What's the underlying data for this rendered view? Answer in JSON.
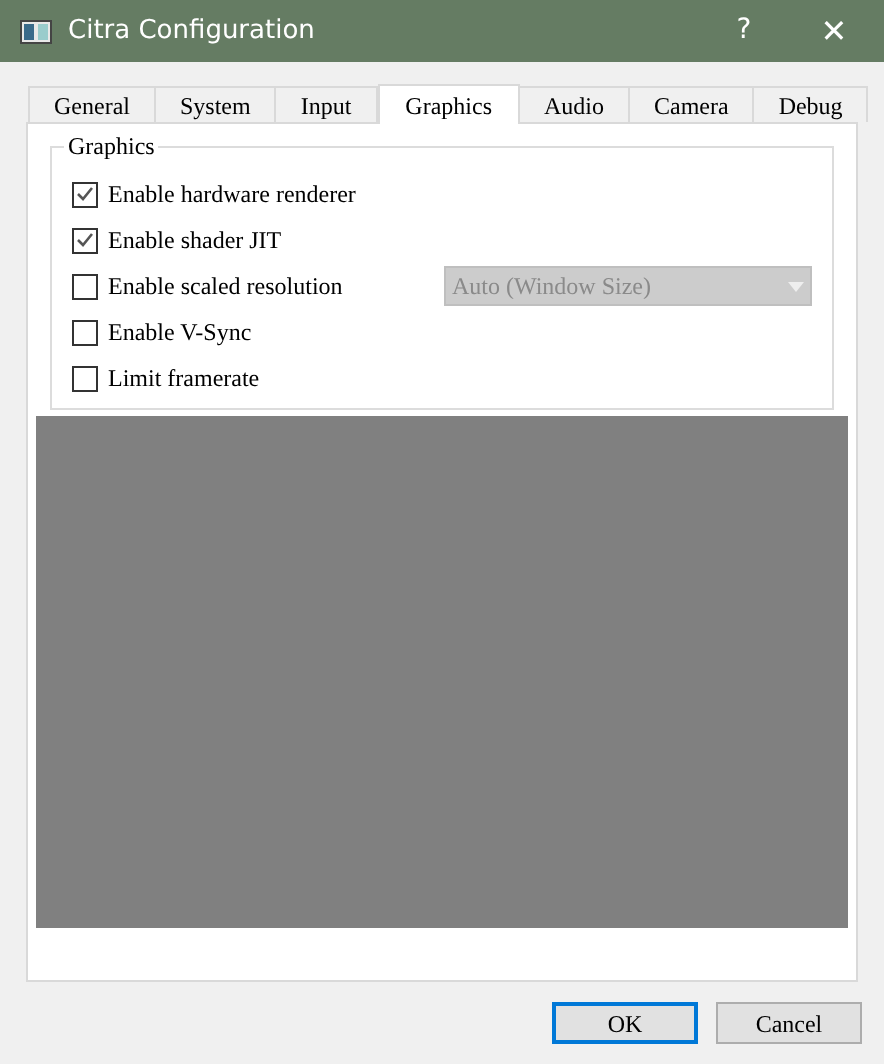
{
  "window": {
    "title": "Citra Configuration",
    "help": "?",
    "close": "✕"
  },
  "tabs": [
    {
      "label": "General",
      "selected": false
    },
    {
      "label": "System",
      "selected": false
    },
    {
      "label": "Input",
      "selected": false
    },
    {
      "label": "Graphics",
      "selected": true
    },
    {
      "label": "Audio",
      "selected": false
    },
    {
      "label": "Camera",
      "selected": false
    },
    {
      "label": "Debug",
      "selected": false
    }
  ],
  "group": {
    "title": "Graphics",
    "options": [
      {
        "label": "Enable hardware renderer",
        "checked": true
      },
      {
        "label": "Enable shader JIT",
        "checked": true
      },
      {
        "label": "Enable scaled resolution",
        "checked": false,
        "dropdown": {
          "value": "Auto (Window Size)",
          "disabled": true
        }
      },
      {
        "label": "Enable V-Sync",
        "checked": false
      },
      {
        "label": "Limit framerate",
        "checked": false
      }
    ]
  },
  "buttons": [
    {
      "label": "OK",
      "default": true
    },
    {
      "label": "Cancel",
      "default": false
    }
  ]
}
